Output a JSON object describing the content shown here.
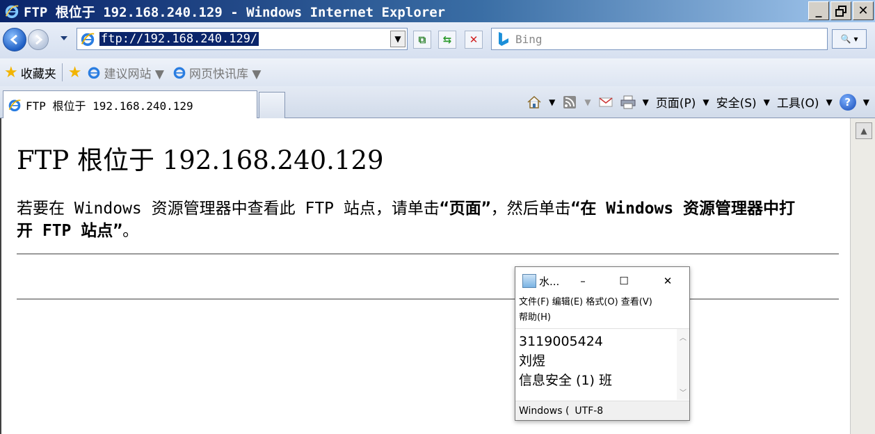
{
  "window": {
    "title": "FTP 根位于 192.168.240.129 - Windows Internet Explorer",
    "min": "_",
    "max": "🗗",
    "close": "✕"
  },
  "address_bar": {
    "url": "ftp://192.168.240.129/",
    "dropdown_glyph": "▼",
    "search_placeholder": "Bing",
    "search_glyph": "🔍",
    "search_dropdown_glyph": "▾"
  },
  "favorites_bar": {
    "label": "收藏夹",
    "items": [
      {
        "label": "建议网站 ▼"
      },
      {
        "label": "网页快讯库 ▼"
      }
    ]
  },
  "tab": {
    "label": "FTP 根位于 192.168.240.129"
  },
  "command_bar": {
    "page": "页面(P)",
    "safety": "安全(S)",
    "tools": "工具(O)",
    "help": "?",
    "dropdown_glyph": "▼"
  },
  "content": {
    "heading": "FTP 根位于 192.168.240.129",
    "instruction_prefix": "若要在 Windows 资源管理器中查看此 FTP 站点，请单击",
    "instruction_page": "“页面”",
    "instruction_middle": "，然后单击",
    "instruction_open": "“在 Windows 资源管理器中打开 FTP 站点”",
    "instruction_suffix": "。"
  },
  "notepad": {
    "title": "水...",
    "minimize": "–",
    "maximize": "☐",
    "close": "✕",
    "menu": {
      "file": "文件(F)",
      "edit": "编辑(E)",
      "format": "格式(O)",
      "view": "查看(V)",
      "help": "帮助(H)"
    },
    "lines": [
      "3119005424",
      "刘煜",
      "信息安全 (1) 班"
    ],
    "status_eol": "Windows (",
    "status_encoding": "UTF-8"
  },
  "colors": {
    "title_bar": "#0a246a",
    "url_highlight": "#0a246a"
  },
  "icons": [
    "ie-icon",
    "back-icon",
    "forward-icon",
    "refresh-icon",
    "stop-icon",
    "compat-icon",
    "bing-icon",
    "search-icon",
    "star-icon",
    "add-favorites-icon",
    "home-icon",
    "rss-icon",
    "mail-icon",
    "print-icon",
    "help-icon",
    "notepad-icon"
  ]
}
